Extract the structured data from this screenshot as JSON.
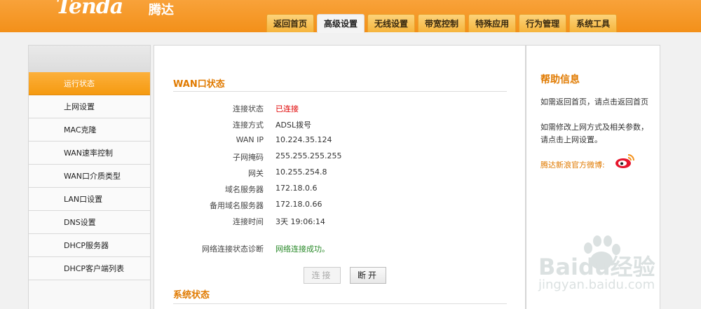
{
  "brand": {
    "logo": "Tenda",
    "logo_cn": "腾达"
  },
  "tabs": [
    {
      "label": "返回首页",
      "active": false
    },
    {
      "label": "高级设置",
      "active": true
    },
    {
      "label": "无线设置",
      "active": false
    },
    {
      "label": "带宽控制",
      "active": false
    },
    {
      "label": "特殊应用",
      "active": false
    },
    {
      "label": "行为管理",
      "active": false
    },
    {
      "label": "系统工具",
      "active": false
    }
  ],
  "sidebar": {
    "items": [
      {
        "label": "运行状态",
        "active": true
      },
      {
        "label": "上网设置"
      },
      {
        "label": "MAC克隆"
      },
      {
        "label": "WAN速率控制"
      },
      {
        "label": "WAN口介质类型"
      },
      {
        "label": "LAN口设置"
      },
      {
        "label": "DNS设置"
      },
      {
        "label": "DHCP服务器"
      },
      {
        "label": "DHCP客户端列表"
      }
    ]
  },
  "wan": {
    "title": "WAN口状态",
    "rows": [
      {
        "label": "连接状态",
        "value": "已连接"
      },
      {
        "label": "连接方式",
        "value": "ADSL拨号"
      },
      {
        "label": "WAN IP",
        "value": "10.224.35.124"
      },
      {
        "label": "子网掩码",
        "value": "255.255.255.255"
      },
      {
        "label": "网关",
        "value": "10.255.254.8"
      },
      {
        "label": "域名服务器",
        "value": "172.18.0.6"
      },
      {
        "label": "备用域名服务器",
        "value": "172.18.0.66"
      },
      {
        "label": "连接时间",
        "value": "3天 19:06:14"
      }
    ],
    "diagnose_label": "网络连接状态诊断",
    "diagnose_value": "网络连接成功。",
    "connect_button": "连接",
    "disconnect_button": "断开"
  },
  "system": {
    "title": "系统状态"
  },
  "help": {
    "title": "帮助信息",
    "text1": "如需返回首页，请点击返回首页",
    "text2": "如需修改上网方式及相关参数，请点击上网设置。",
    "weibo": "腾达新浪官方微博:"
  },
  "watermark": {
    "brand": "Baidu经验",
    "url": "jingyan.baidu.com"
  },
  "colors": {
    "accent": "#f7931e",
    "title": "#e07a00",
    "connected": "#e00000",
    "success": "#2a8a2a"
  }
}
